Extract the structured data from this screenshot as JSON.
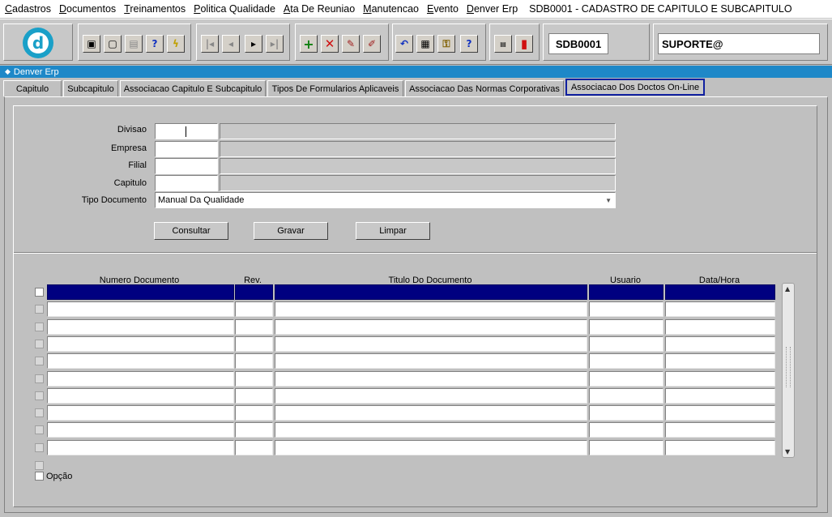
{
  "menu": {
    "items": [
      {
        "label": "Cadastros"
      },
      {
        "label": "Documentos"
      },
      {
        "label": "Treinamentos"
      },
      {
        "label": "Politica Qualidade"
      },
      {
        "label": "Ata De Reuniao"
      },
      {
        "label": "Manutencao"
      },
      {
        "label": "Evento"
      },
      {
        "label": "Denver Erp"
      }
    ],
    "title": "SDB0001 - CADASTRO DE CAPITULO E SUBCAPITULO"
  },
  "toolbar": {
    "form_code": "SDB0001",
    "user": "SUPORTE@",
    "icons": [
      "save-icon",
      "window-icon",
      "print-icon",
      "help-query-icon",
      "lightning-icon",
      "first-record-icon",
      "prev-record-icon",
      "next-record-icon",
      "last-record-icon",
      "insert-record-icon",
      "delete-record-icon",
      "query-icon",
      "clear-icon",
      "undo-icon",
      "clipboard-icon",
      "key-icon",
      "help-icon",
      "menu-icon",
      "exit-icon"
    ]
  },
  "window": {
    "title": "Denver Erp"
  },
  "tabs": [
    {
      "label": "Capitulo"
    },
    {
      "label": "Subcapitulo"
    },
    {
      "label": "Associacao Capitulo E Subcapitulo"
    },
    {
      "label": "Tipos De Formularios Aplicaveis"
    },
    {
      "label": "Associacao Das Normas Corporativas"
    },
    {
      "label": "Associacao Dos Doctos On-Line"
    }
  ],
  "form": {
    "divisao_label": "Divisao",
    "empresa_label": "Empresa",
    "filial_label": "Filial",
    "capitulo_label": "Capitulo",
    "tipo_documento_label": "Tipo Documento",
    "tipo_documento_value": "Manual Da Qualidade"
  },
  "buttons": {
    "consultar": "Consultar",
    "gravar": "Gravar",
    "limpar": "Limpar"
  },
  "grid": {
    "columns": [
      "Numero Documento",
      "Rev.",
      "Titulo Do Documento",
      "Usuario",
      "Data/Hora"
    ],
    "row_count": 10
  },
  "option": {
    "label": "Opção"
  },
  "colors": {
    "accent": "#1e88c8",
    "selection": "#000080",
    "active_tab_border": "#1020a0"
  }
}
